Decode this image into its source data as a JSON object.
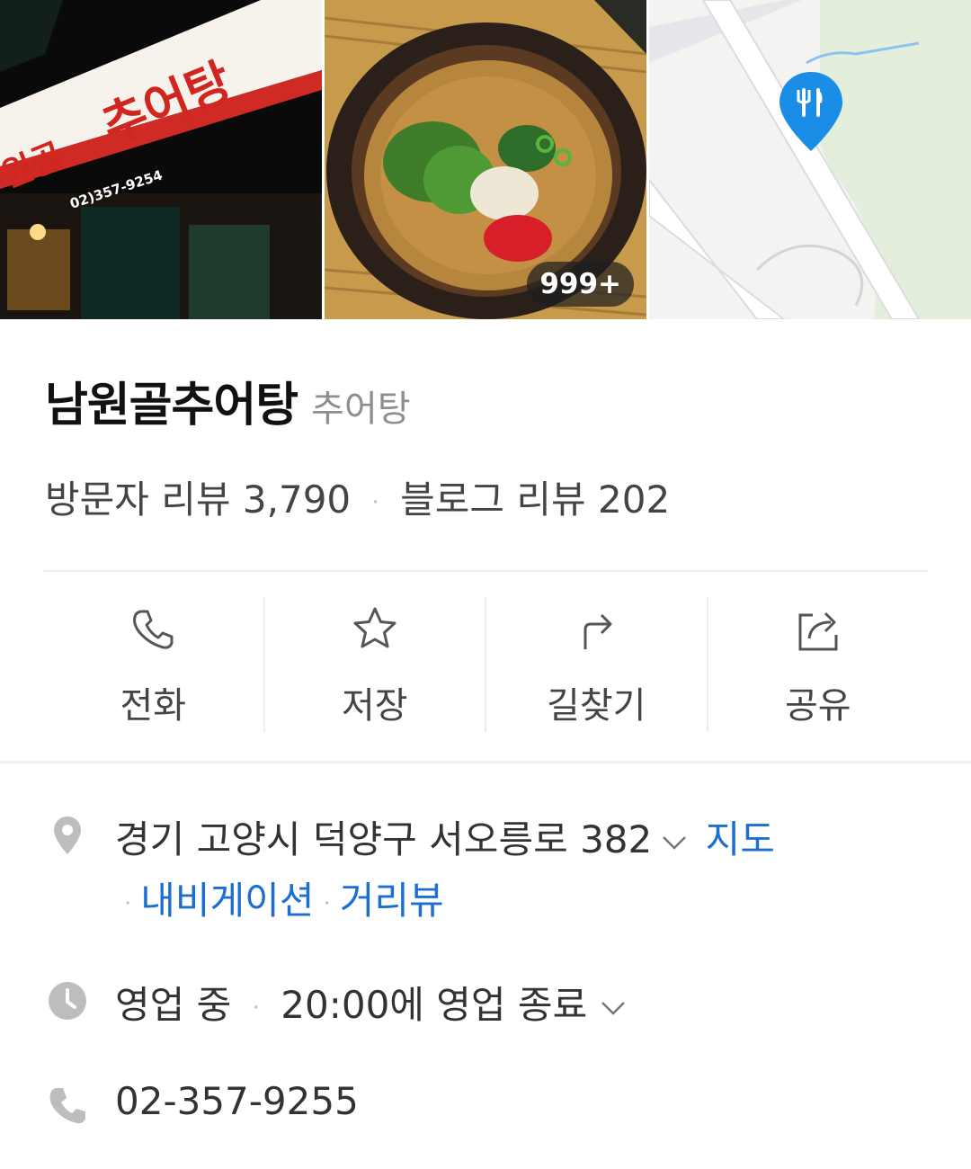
{
  "photos": {
    "photo_count_badge": "999+",
    "storefront_sign": {
      "main": "추어탕",
      "side": "원골",
      "phone": "02)357-9254"
    }
  },
  "place": {
    "name": "남원골추어탕",
    "category": "추어탕",
    "visitor_review_label": "방문자 리뷰 3,790",
    "blog_review_label": "블로그 리뷰 202",
    "separator": "·"
  },
  "actions": [
    {
      "label": "전화",
      "icon": "phone-icon"
    },
    {
      "label": "저장",
      "icon": "star-icon"
    },
    {
      "label": "길찾기",
      "icon": "directions-icon"
    },
    {
      "label": "공유",
      "icon": "share-icon"
    }
  ],
  "address": {
    "text": "경기 고양시 덕양구 서오릉로 382",
    "map_link": "지도",
    "navigation_link": "내비게이션",
    "streetview_link": "거리뷰"
  },
  "hours": {
    "status": "영업 중",
    "detail": "20:00에 영업 종료"
  },
  "phone": {
    "number": "02-357-9255"
  },
  "colors": {
    "link": "#1c6fd0",
    "map_pin": "#1a8de6",
    "icon_gray": "#bdbdbd"
  }
}
